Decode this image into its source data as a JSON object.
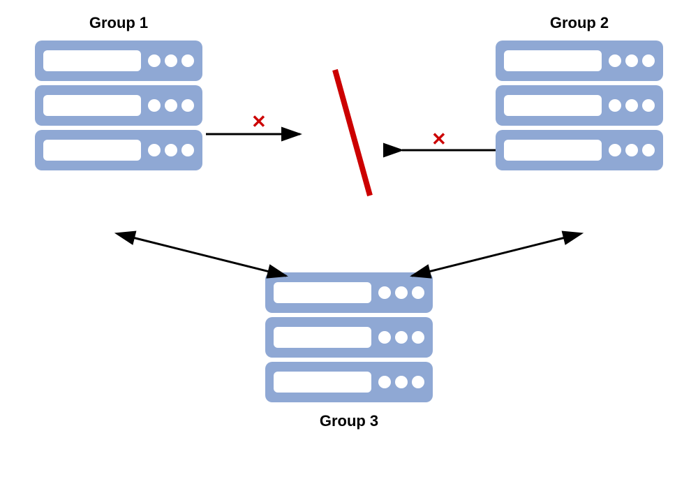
{
  "groups": {
    "group1": {
      "label": "Group 1",
      "position": "top-left"
    },
    "group2": {
      "label": "Group 2",
      "position": "top-right"
    },
    "group3": {
      "label": "Group 3",
      "position": "bottom-center"
    }
  },
  "colors": {
    "server_bg": "#8fa8d4",
    "server_element": "#ffffff",
    "arrow": "#000000",
    "lightning": "#cc0000",
    "x_mark": "#cc0000"
  }
}
